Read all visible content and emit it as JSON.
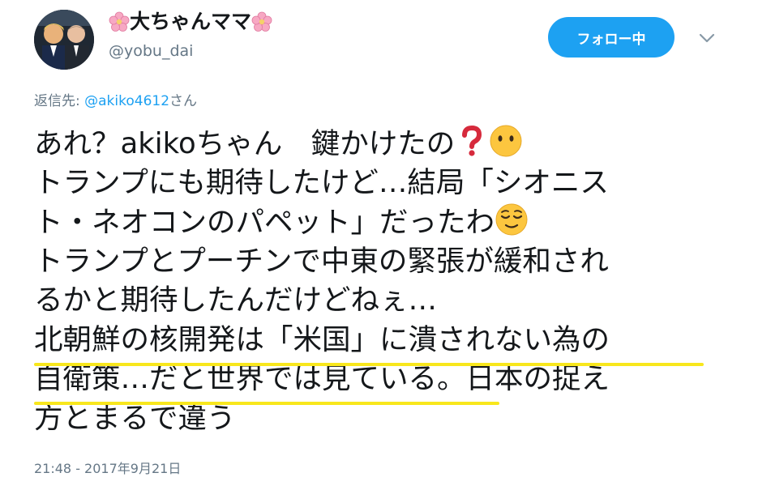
{
  "author": {
    "name_prefix_emoji": "cherry-blossom",
    "display_name": "大ちゃんママ",
    "name_suffix_emoji": "cherry-blossom",
    "handle": "@yobu_dai"
  },
  "follow_button": {
    "label": "フォロー中"
  },
  "reply": {
    "label": "返信先: ",
    "mention": "@akiko4612",
    "suffix": "さん"
  },
  "tweet": {
    "lines": [
      "あれ？akikoちゃん　鍵かけたの",
      "トランプにも期待したけど…結局「シオニス",
      "ト・ネオコンのパペット」だったわ",
      "トランプとプーチンで中東の緊張が緩和され",
      "るかと期待したんだけどねぇ…",
      "北朝鮮の核開発は「米国」に潰されない為の",
      "自衛策…だと世界では見ている。日本の捉え",
      "方とまるで違う"
    ],
    "emojis": [
      "red-question-mark",
      "face-without-mouth",
      "relieved-face"
    ],
    "highlight_color": "#f8e71c"
  },
  "timestamp": "21:48 - 2017年9月21日",
  "colors": {
    "accent": "#1da1f2",
    "text": "#14171a",
    "muted": "#657786"
  }
}
